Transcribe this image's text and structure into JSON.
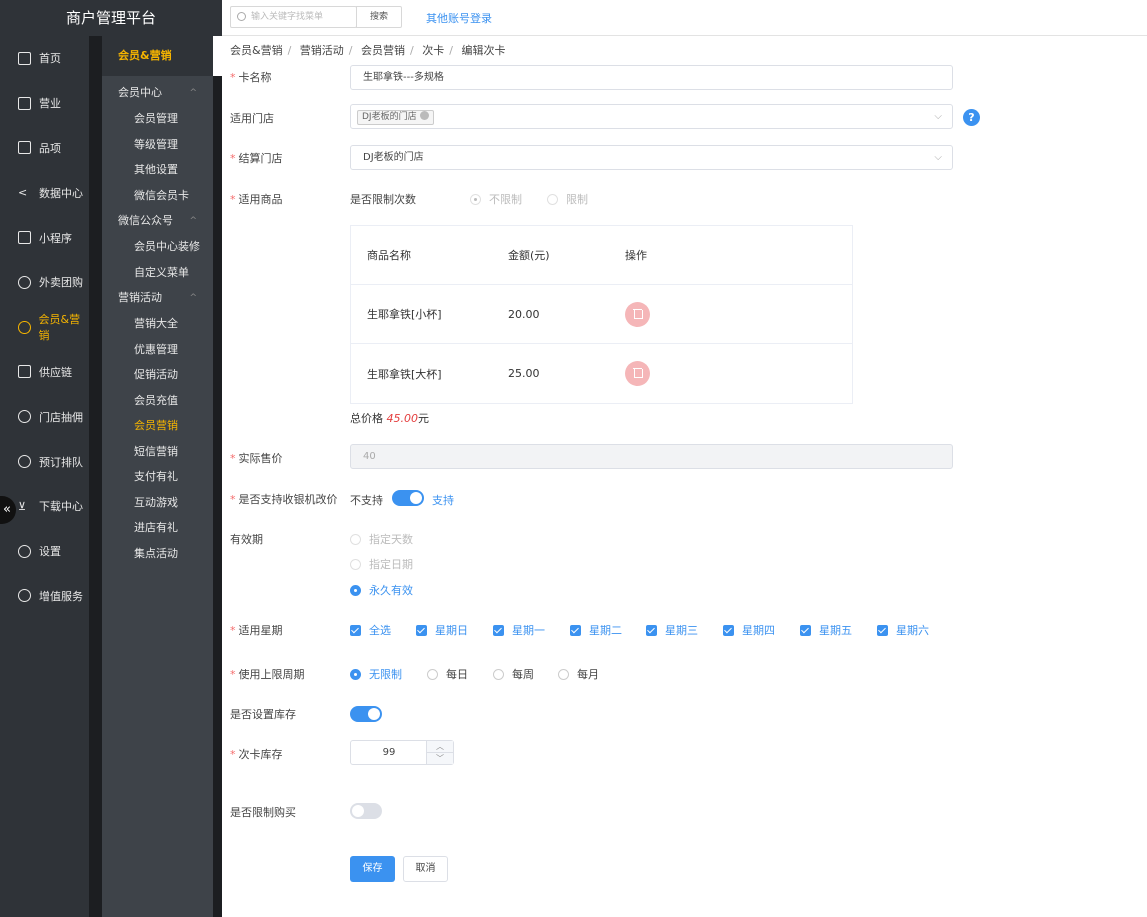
{
  "app": {
    "title": "商户管理平台"
  },
  "sidebar": {
    "items": [
      {
        "label": "首页",
        "icon": "home-icon"
      },
      {
        "label": "营业",
        "icon": "calendar-icon"
      },
      {
        "label": "品项",
        "icon": "bag-icon"
      },
      {
        "label": "数据中心",
        "icon": "share-icon"
      },
      {
        "label": "小程序",
        "icon": "phone-icon"
      },
      {
        "label": "外卖团购",
        "icon": "bike-icon"
      },
      {
        "label": "会员&营销",
        "icon": "user-icon"
      },
      {
        "label": "供应链",
        "icon": "truck-icon"
      },
      {
        "label": "门店抽佣",
        "icon": "database-icon"
      },
      {
        "label": "预订排队",
        "icon": "clock-icon"
      },
      {
        "label": "下载中心",
        "icon": "download-icon"
      },
      {
        "label": "设置",
        "icon": "gear-icon"
      },
      {
        "label": "增值服务",
        "icon": "alarm-icon"
      }
    ],
    "collapse_glyph": "«"
  },
  "subnav": {
    "title": "会员&营销",
    "groups": [
      {
        "label": "会员中心",
        "items": [
          "会员管理",
          "等级管理",
          "其他设置",
          "微信会员卡"
        ]
      },
      {
        "label": "微信公众号",
        "items": [
          "会员中心装修",
          "自定义菜单"
        ]
      },
      {
        "label": "营销活动",
        "items": [
          "营销大全",
          "优惠管理",
          "促销活动",
          "会员充值",
          "会员营销",
          "短信营销",
          "支付有礼",
          "互动游戏",
          "进店有礼",
          "集点活动"
        ]
      }
    ]
  },
  "topbar": {
    "search_placeholder": "输入关键字找菜单",
    "search_button": "搜索",
    "other_login": "其他账号登录"
  },
  "breadcrumb": [
    "会员&营销",
    "营销活动",
    "会员营销",
    "次卡",
    "编辑次卡"
  ],
  "form": {
    "card_name": {
      "label": "卡名称",
      "value": "生耶拿铁---多规格"
    },
    "stores": {
      "label": "适用门店",
      "tag": "DJ老板的门店"
    },
    "settle_store": {
      "label": "结算门店",
      "value": "DJ老板的门店"
    },
    "goods": {
      "label": "适用商品",
      "limit_label": "是否限制次数",
      "options": [
        "不限制",
        "限制"
      ],
      "columns": [
        "商品名称",
        "金额(元)",
        "操作"
      ],
      "rows": [
        {
          "name": "生耶拿铁[小杯]",
          "amount": "20.00"
        },
        {
          "name": "生耶拿铁[大杯]",
          "amount": "25.00"
        }
      ],
      "total_prefix": "总价格",
      "total_value": "45.00",
      "total_suffix": "元"
    },
    "actual_price": {
      "label": "实际售价",
      "value": "40"
    },
    "cashier_change": {
      "label": "是否支持收银机改价",
      "off_text": "不支持",
      "on_text": "支持"
    },
    "validity": {
      "label": "有效期",
      "options": [
        "指定天数",
        "指定日期",
        "永久有效"
      ]
    },
    "weekdays": {
      "label": "适用星期",
      "options": [
        "全选",
        "星期日",
        "星期一",
        "星期二",
        "星期三",
        "星期四",
        "星期五",
        "星期六"
      ]
    },
    "usage_period": {
      "label": "使用上限周期",
      "options": [
        "无限制",
        "每日",
        "每周",
        "每月"
      ]
    },
    "set_stock": {
      "label": "是否设置库存"
    },
    "stock": {
      "label": "次卡库存",
      "value": "99"
    },
    "limit_purchase": {
      "label": "是否限制购买"
    },
    "save": "保存",
    "cancel": "取消"
  },
  "colors": {
    "accent": "#3b92f0",
    "sidebar_active": "#f5b400",
    "sidebar_bg": "#2f3338"
  }
}
